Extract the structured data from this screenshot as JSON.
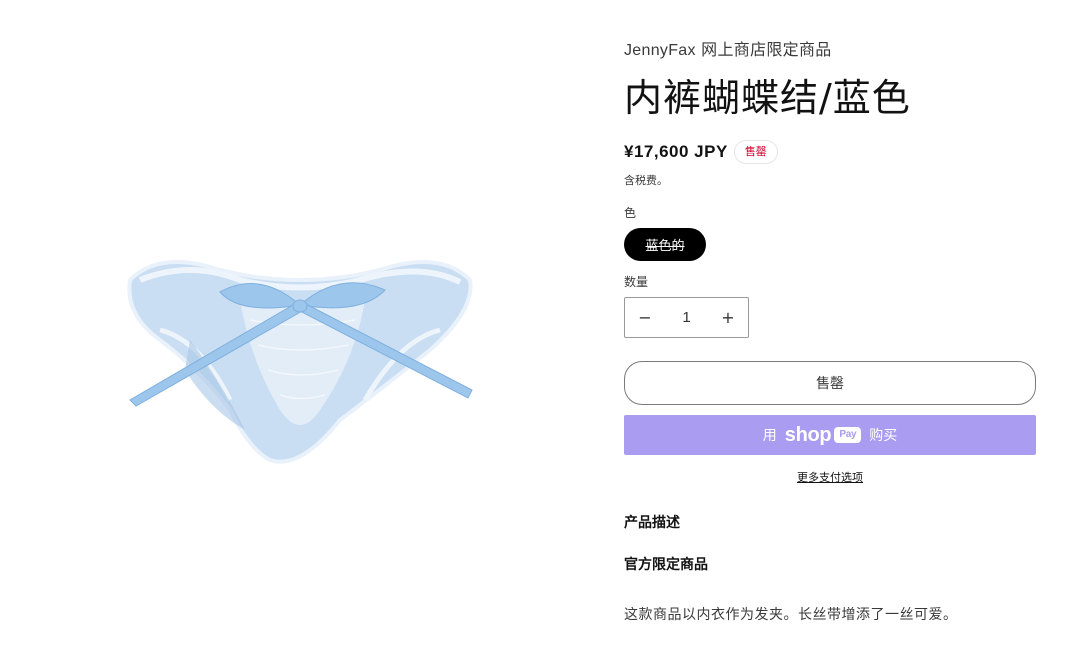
{
  "vendor": {
    "brand": "JennyFax",
    "suffix": " 网上商店限定商品"
  },
  "product": {
    "title": "内裤蝴蝶结/蓝色",
    "price": "¥17,600 JPY",
    "badge": "售罄",
    "tax_note": "含税费。",
    "image_alt": "light blue lace briefs with satin bow"
  },
  "variant": {
    "label": "色",
    "selected": "蓝色的"
  },
  "quantity": {
    "label": "数量",
    "value": "1",
    "minus": "−",
    "plus": "+"
  },
  "buttons": {
    "sold_out": "售罄",
    "shop_prefix": "用",
    "shop_word": "shop",
    "shop_pay": "Pay",
    "shop_suffix": "购买",
    "more_payment": "更多支付选项"
  },
  "description": {
    "heading": "产品描述",
    "subheading": "官方限定商品",
    "text": "这款商品以内衣作为发夹。长丝带增添了一丝可爱。"
  },
  "colors": {
    "shop_pay_bg": "#a99cf1",
    "badge_text": "#d1002c",
    "variant_bg": "#000000"
  }
}
